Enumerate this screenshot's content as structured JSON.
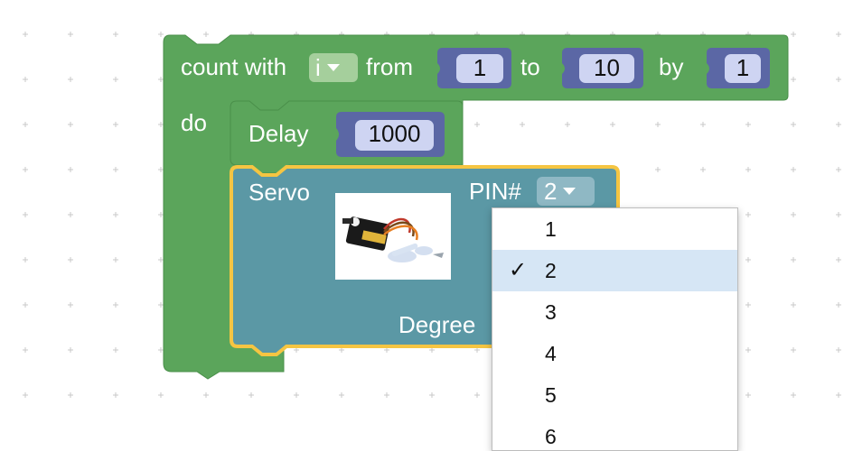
{
  "colors": {
    "loop_block": "#5ba55b",
    "servo_block": "#5b98a5",
    "number_block": "#5b67a5",
    "selection_outline": "#f5c542",
    "dropdown_selected": "#d6e6f5"
  },
  "loop_block": {
    "label_count_with": "count with",
    "variable": "i",
    "label_from": "from",
    "from_value": "1",
    "label_to": "to",
    "to_value": "10",
    "label_by": "by",
    "by_value": "1",
    "label_do": "do"
  },
  "delay_block": {
    "label": "Delay",
    "value": "1000"
  },
  "servo_block": {
    "label": "Servo",
    "pin_label": "PIN#",
    "pin_value": "2",
    "degree_label": "Degree",
    "image_icon": "servo-motor-image"
  },
  "pin_dropdown": {
    "options": [
      "1",
      "2",
      "3",
      "4",
      "5",
      "6"
    ],
    "selected": "2",
    "check_mark": "✓"
  }
}
